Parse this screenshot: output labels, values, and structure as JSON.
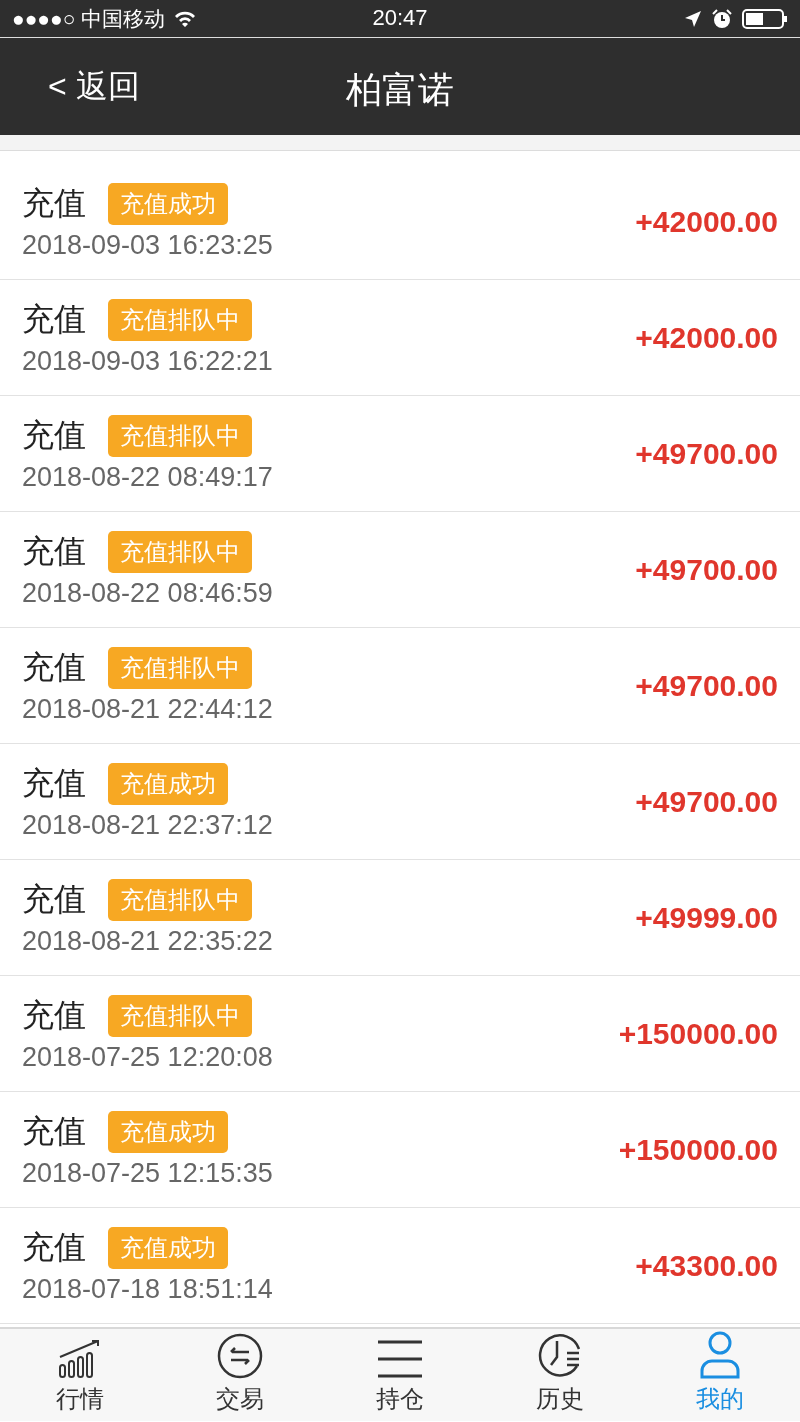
{
  "status_bar": {
    "carrier": "●●●●○ 中国移动",
    "time": "20:47"
  },
  "nav": {
    "back": "< 返回",
    "title": "柏富诺"
  },
  "records": [
    {
      "type": "充值",
      "status": "充值成功",
      "time": "2018-09-03 16:23:25",
      "amount": "+42000.00"
    },
    {
      "type": "充值",
      "status": "充值排队中",
      "time": "2018-09-03 16:22:21",
      "amount": "+42000.00"
    },
    {
      "type": "充值",
      "status": "充值排队中",
      "time": "2018-08-22 08:49:17",
      "amount": "+49700.00"
    },
    {
      "type": "充值",
      "status": "充值排队中",
      "time": "2018-08-22 08:46:59",
      "amount": "+49700.00"
    },
    {
      "type": "充值",
      "status": "充值排队中",
      "time": "2018-08-21 22:44:12",
      "amount": "+49700.00"
    },
    {
      "type": "充值",
      "status": "充值成功",
      "time": "2018-08-21 22:37:12",
      "amount": "+49700.00"
    },
    {
      "type": "充值",
      "status": "充值排队中",
      "time": "2018-08-21 22:35:22",
      "amount": "+49999.00"
    },
    {
      "type": "充值",
      "status": "充值排队中",
      "time": "2018-07-25 12:20:08",
      "amount": "+150000.00"
    },
    {
      "type": "充值",
      "status": "充值成功",
      "time": "2018-07-25 12:15:35",
      "amount": "+150000.00"
    },
    {
      "type": "充值",
      "status": "充值成功",
      "time": "2018-07-18 18:51:14",
      "amount": "+43300.00"
    }
  ],
  "tab_bar": [
    {
      "label": "行情",
      "kind": "chart",
      "selected": false
    },
    {
      "label": "交易",
      "kind": "exchange",
      "selected": false
    },
    {
      "label": "持仓",
      "kind": "lines",
      "selected": false
    },
    {
      "label": "历史",
      "kind": "clock",
      "selected": false
    },
    {
      "label": "我的",
      "kind": "person",
      "selected": true
    }
  ]
}
